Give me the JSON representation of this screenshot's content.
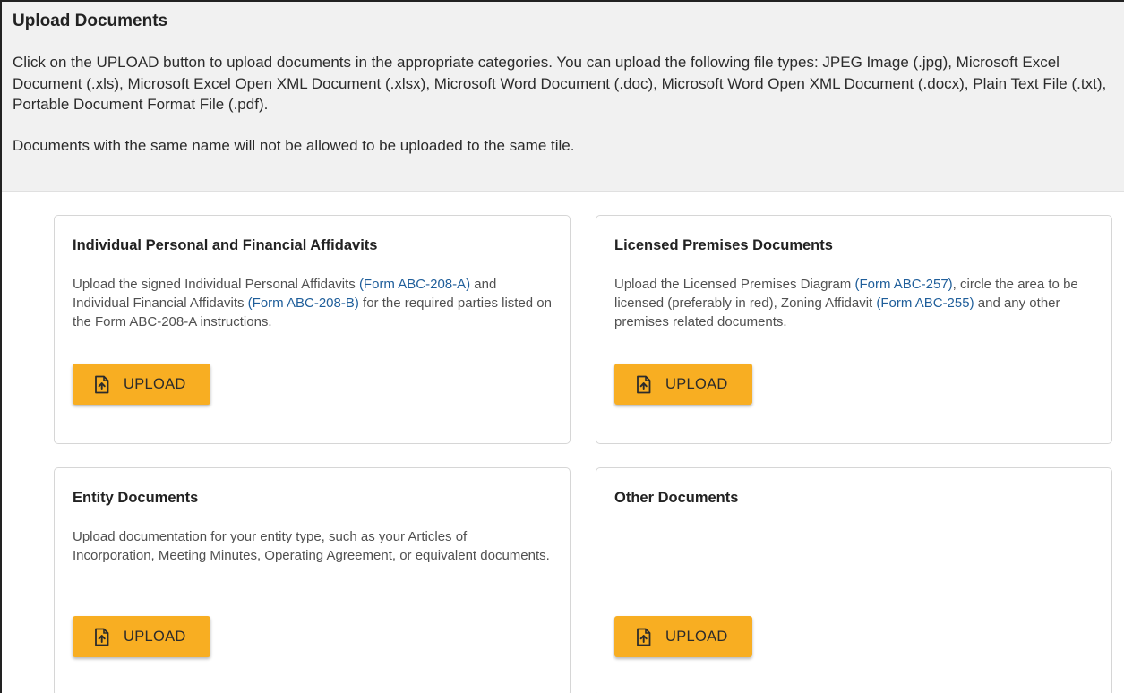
{
  "page": {
    "title": "Upload Documents",
    "intro": "Click on the UPLOAD button to upload documents in the appropriate categories. You can upload the following file types: JPEG Image (.jpg), Microsoft Excel Document (.xls), Microsoft Excel Open XML Document (.xlsx), Microsoft Word Document (.doc), Microsoft Word Open XML Document (.docx), Plain Text File (.txt), Portable Document Format File (.pdf).",
    "note": "Documents with the same name will not be allowed to be uploaded to the same tile."
  },
  "colors": {
    "button_bg": "#f8ae22",
    "link": "#1f5e9a",
    "header_bg": "#f1f1f1"
  },
  "cards": [
    {
      "title": "Individual Personal and Financial Affidavits",
      "desc_1": "Upload the signed Individual Personal Affidavits ",
      "link_1": "(Form ABC-208-A)",
      "desc_2": " and Individual Financial Affidavits ",
      "link_2": "(Form ABC-208-B)",
      "desc_3": " for the required parties listed on the Form ABC-208-A instructions.",
      "button_label": "UPLOAD",
      "button_icon": "file-upload-icon"
    },
    {
      "title": "Licensed Premises Documents",
      "desc_1": "Upload the Licensed Premises Diagram ",
      "link_1": "(Form ABC-257)",
      "desc_2": ", circle the area to be licensed (preferably in red), Zoning Affidavit ",
      "link_2": "(Form ABC-255)",
      "desc_3": " and any other premises related documents.",
      "button_label": "UPLOAD",
      "button_icon": "file-upload-icon"
    },
    {
      "title": "Entity Documents",
      "desc": "Upload documentation for your entity type, such as your Articles of Incorporation, Meeting Minutes, Operating Agreement, or equivalent documents.",
      "button_label": "UPLOAD",
      "button_icon": "file-upload-icon"
    },
    {
      "title": "Other Documents",
      "desc": "",
      "button_label": "UPLOAD",
      "button_icon": "file-upload-icon"
    }
  ]
}
